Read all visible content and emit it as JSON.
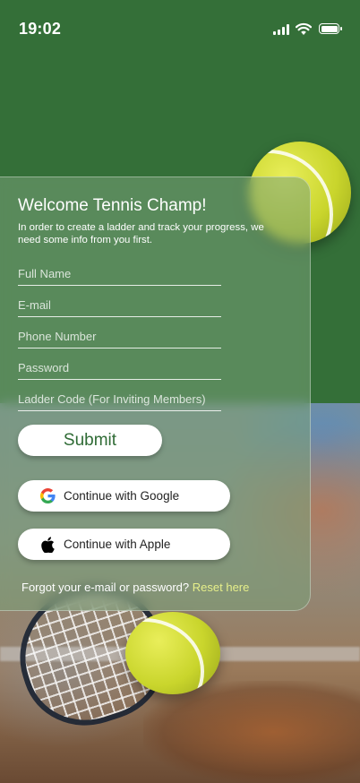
{
  "status_bar": {
    "time": "19:02",
    "icons": [
      "signal-icon",
      "wifi-icon",
      "battery-icon"
    ]
  },
  "form": {
    "title": "Welcome Tennis Champ!",
    "subtitle": "In order to create a ladder and track your progress, we need some info from you first.",
    "fields": [
      {
        "placeholder": "Full Name",
        "value": ""
      },
      {
        "placeholder": "E-mail",
        "value": ""
      },
      {
        "placeholder": "Phone Number",
        "value": ""
      },
      {
        "placeholder": "Password",
        "value": ""
      },
      {
        "placeholder": "Ladder Code (For Inviting Members)",
        "value": ""
      }
    ],
    "submit_label": "Submit",
    "google_label": "Continue with Google",
    "apple_label": "Continue with Apple",
    "forgot_text": "Forgot your e-mail or password?",
    "reset_link": "Reset here"
  },
  "colors": {
    "brand_green": "#346f38",
    "submit_text": "#2f6b35",
    "link_color": "#e6ef8a"
  }
}
